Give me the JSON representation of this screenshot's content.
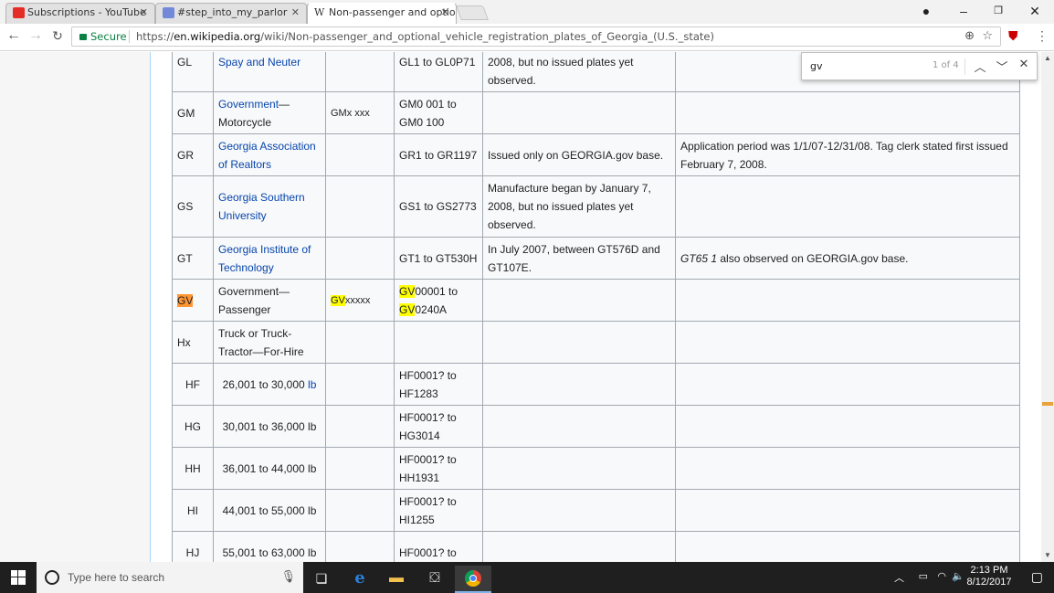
{
  "tabs": [
    {
      "title": "Subscriptions - YouTube",
      "icon": "youtube-icon",
      "color": "#e52d27"
    },
    {
      "title": "#step_into_my_parlor",
      "icon": "discord-icon",
      "color": "#7289da"
    },
    {
      "title": "Non-passenger and optio",
      "icon": "wikipedia-icon",
      "color": "#333333"
    }
  ],
  "address": {
    "secure_label": "Secure",
    "url_prefix": "https://",
    "url_host": "en.wikipedia.org",
    "url_path": "/wiki/Non-passenger_and_optional_vehicle_registration_plates_of_Georgia_(U.S._state)"
  },
  "find": {
    "query": "gv",
    "count": "1 of 4"
  },
  "table": {
    "rows": [
      {
        "code": "GL",
        "name": "Spay and Neuter",
        "name_link": true,
        "format": "",
        "serial": "GL1 to GL0P71",
        "notes": "Manufacture began by January 7, 2008, but no issued plates yet observed.",
        "remarks": ""
      },
      {
        "code": "GM",
        "name": "Government—Motorcycle",
        "name_link_part": "Government",
        "name_rest": "—Motorcycle",
        "format": "GMx xxx",
        "serial": "GM0 001 to GM0 100",
        "notes": "",
        "remarks": ""
      },
      {
        "code": "GR",
        "name": "Georgia Association of Realtors",
        "name_link": true,
        "format": "",
        "serial": "GR1 to GR1197",
        "notes": "Issued only on GEORGIA.gov base.",
        "remarks": "Application period was 1/1/07-12/31/08. Tag clerk stated first issued February 7, 2008."
      },
      {
        "code": "GS",
        "name": "Georgia Southern University",
        "name_link": true,
        "format": "",
        "serial": "GS1 to GS2773",
        "notes": "Manufacture began by January 7, 2008, but no issued plates yet observed.",
        "remarks": ""
      },
      {
        "code": "GT",
        "name": "Georgia Institute of Technology",
        "name_link": true,
        "format": "",
        "serial": "GT1 to GT530H",
        "notes": "In July 2007, between GT576D and GT107E.",
        "remarks_italic": "GT65 1",
        "remarks": " also observed on GEORGIA.gov base."
      },
      {
        "code": "GV",
        "name": "Government—Passenger",
        "format_hl": "GV",
        "format_rest": "xxxxx",
        "serial_hl1": "GV",
        "serial_a": "00001 to",
        "serial_hl2": "GV",
        "serial_b": "0240A",
        "notes": "",
        "remarks": ""
      },
      {
        "code": "Hx",
        "name": "Truck or Truck-Tractor—For-Hire",
        "format": "",
        "serial": "",
        "notes": "",
        "remarks": ""
      },
      {
        "code": "HF",
        "name_range": "26,001 to 30,000",
        "unit": "lb",
        "unit_link": true,
        "serial": "HF0001? to HF1283"
      },
      {
        "code": "HG",
        "name_range": "30,001 to 36,000",
        "unit": "lb",
        "serial": "HF0001? to HG3014"
      },
      {
        "code": "HH",
        "name_range": "36,001 to 44,000",
        "unit": "lb",
        "serial": "HF0001? to HH1931"
      },
      {
        "code": "HI",
        "name_range": "44,001 to 55,000",
        "unit": "lb",
        "serial": "HF0001? to HI1255"
      },
      {
        "code": "HJ",
        "name_range": "55,001 to 63,000",
        "unit": "lb",
        "serial": "HF0001? to"
      }
    ]
  },
  "taskbar": {
    "search_placeholder": "Type here to search",
    "time": "2:13 PM",
    "date": "8/12/2017"
  }
}
